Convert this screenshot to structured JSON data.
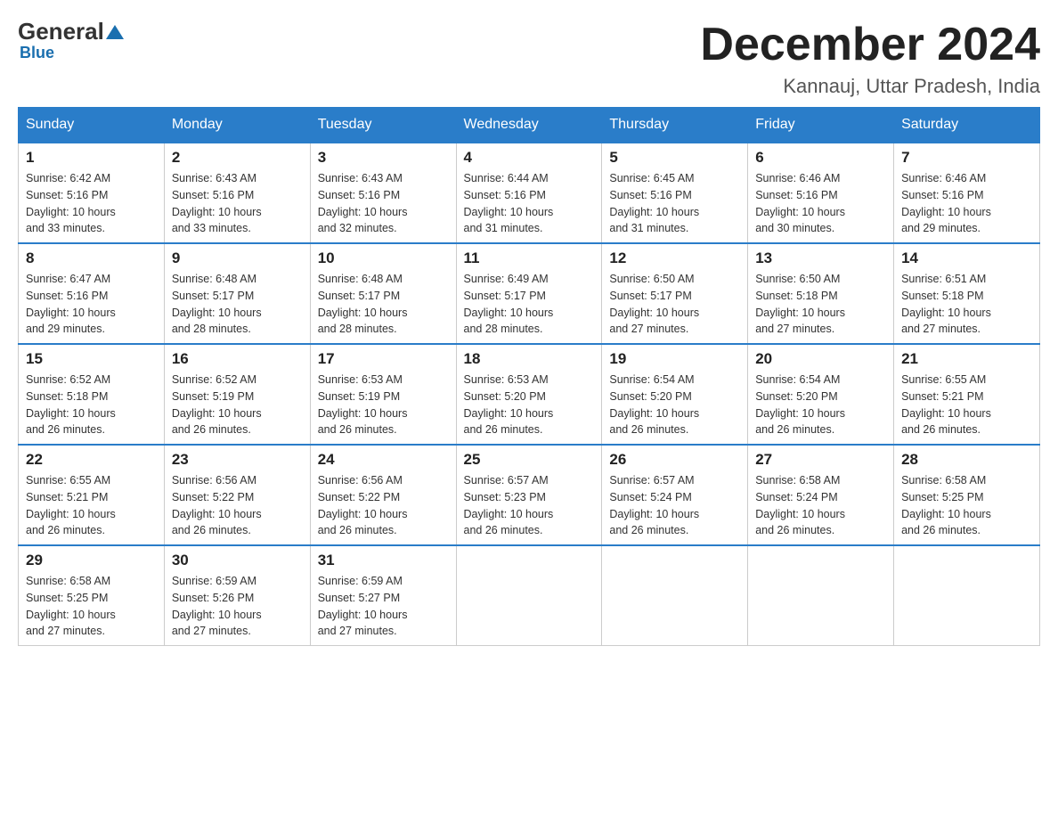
{
  "logo": {
    "general": "General",
    "blue": "Blue",
    "subtitle": "Blue"
  },
  "header": {
    "title": "December 2024",
    "subtitle": "Kannauj, Uttar Pradesh, India"
  },
  "weekdays": [
    "Sunday",
    "Monday",
    "Tuesday",
    "Wednesday",
    "Thursday",
    "Friday",
    "Saturday"
  ],
  "weeks": [
    [
      {
        "day": "1",
        "sunrise": "6:42 AM",
        "sunset": "5:16 PM",
        "daylight": "10 hours and 33 minutes."
      },
      {
        "day": "2",
        "sunrise": "6:43 AM",
        "sunset": "5:16 PM",
        "daylight": "10 hours and 33 minutes."
      },
      {
        "day": "3",
        "sunrise": "6:43 AM",
        "sunset": "5:16 PM",
        "daylight": "10 hours and 32 minutes."
      },
      {
        "day": "4",
        "sunrise": "6:44 AM",
        "sunset": "5:16 PM",
        "daylight": "10 hours and 31 minutes."
      },
      {
        "day": "5",
        "sunrise": "6:45 AM",
        "sunset": "5:16 PM",
        "daylight": "10 hours and 31 minutes."
      },
      {
        "day": "6",
        "sunrise": "6:46 AM",
        "sunset": "5:16 PM",
        "daylight": "10 hours and 30 minutes."
      },
      {
        "day": "7",
        "sunrise": "6:46 AM",
        "sunset": "5:16 PM",
        "daylight": "10 hours and 29 minutes."
      }
    ],
    [
      {
        "day": "8",
        "sunrise": "6:47 AM",
        "sunset": "5:16 PM",
        "daylight": "10 hours and 29 minutes."
      },
      {
        "day": "9",
        "sunrise": "6:48 AM",
        "sunset": "5:17 PM",
        "daylight": "10 hours and 28 minutes."
      },
      {
        "day": "10",
        "sunrise": "6:48 AM",
        "sunset": "5:17 PM",
        "daylight": "10 hours and 28 minutes."
      },
      {
        "day": "11",
        "sunrise": "6:49 AM",
        "sunset": "5:17 PM",
        "daylight": "10 hours and 28 minutes."
      },
      {
        "day": "12",
        "sunrise": "6:50 AM",
        "sunset": "5:17 PM",
        "daylight": "10 hours and 27 minutes."
      },
      {
        "day": "13",
        "sunrise": "6:50 AM",
        "sunset": "5:18 PM",
        "daylight": "10 hours and 27 minutes."
      },
      {
        "day": "14",
        "sunrise": "6:51 AM",
        "sunset": "5:18 PM",
        "daylight": "10 hours and 27 minutes."
      }
    ],
    [
      {
        "day": "15",
        "sunrise": "6:52 AM",
        "sunset": "5:18 PM",
        "daylight": "10 hours and 26 minutes."
      },
      {
        "day": "16",
        "sunrise": "6:52 AM",
        "sunset": "5:19 PM",
        "daylight": "10 hours and 26 minutes."
      },
      {
        "day": "17",
        "sunrise": "6:53 AM",
        "sunset": "5:19 PM",
        "daylight": "10 hours and 26 minutes."
      },
      {
        "day": "18",
        "sunrise": "6:53 AM",
        "sunset": "5:20 PM",
        "daylight": "10 hours and 26 minutes."
      },
      {
        "day": "19",
        "sunrise": "6:54 AM",
        "sunset": "5:20 PM",
        "daylight": "10 hours and 26 minutes."
      },
      {
        "day": "20",
        "sunrise": "6:54 AM",
        "sunset": "5:20 PM",
        "daylight": "10 hours and 26 minutes."
      },
      {
        "day": "21",
        "sunrise": "6:55 AM",
        "sunset": "5:21 PM",
        "daylight": "10 hours and 26 minutes."
      }
    ],
    [
      {
        "day": "22",
        "sunrise": "6:55 AM",
        "sunset": "5:21 PM",
        "daylight": "10 hours and 26 minutes."
      },
      {
        "day": "23",
        "sunrise": "6:56 AM",
        "sunset": "5:22 PM",
        "daylight": "10 hours and 26 minutes."
      },
      {
        "day": "24",
        "sunrise": "6:56 AM",
        "sunset": "5:22 PM",
        "daylight": "10 hours and 26 minutes."
      },
      {
        "day": "25",
        "sunrise": "6:57 AM",
        "sunset": "5:23 PM",
        "daylight": "10 hours and 26 minutes."
      },
      {
        "day": "26",
        "sunrise": "6:57 AM",
        "sunset": "5:24 PM",
        "daylight": "10 hours and 26 minutes."
      },
      {
        "day": "27",
        "sunrise": "6:58 AM",
        "sunset": "5:24 PM",
        "daylight": "10 hours and 26 minutes."
      },
      {
        "day": "28",
        "sunrise": "6:58 AM",
        "sunset": "5:25 PM",
        "daylight": "10 hours and 26 minutes."
      }
    ],
    [
      {
        "day": "29",
        "sunrise": "6:58 AM",
        "sunset": "5:25 PM",
        "daylight": "10 hours and 27 minutes."
      },
      {
        "day": "30",
        "sunrise": "6:59 AM",
        "sunset": "5:26 PM",
        "daylight": "10 hours and 27 minutes."
      },
      {
        "day": "31",
        "sunrise": "6:59 AM",
        "sunset": "5:27 PM",
        "daylight": "10 hours and 27 minutes."
      },
      null,
      null,
      null,
      null
    ]
  ],
  "labels": {
    "sunrise": "Sunrise:",
    "sunset": "Sunset:",
    "daylight": "Daylight:"
  }
}
